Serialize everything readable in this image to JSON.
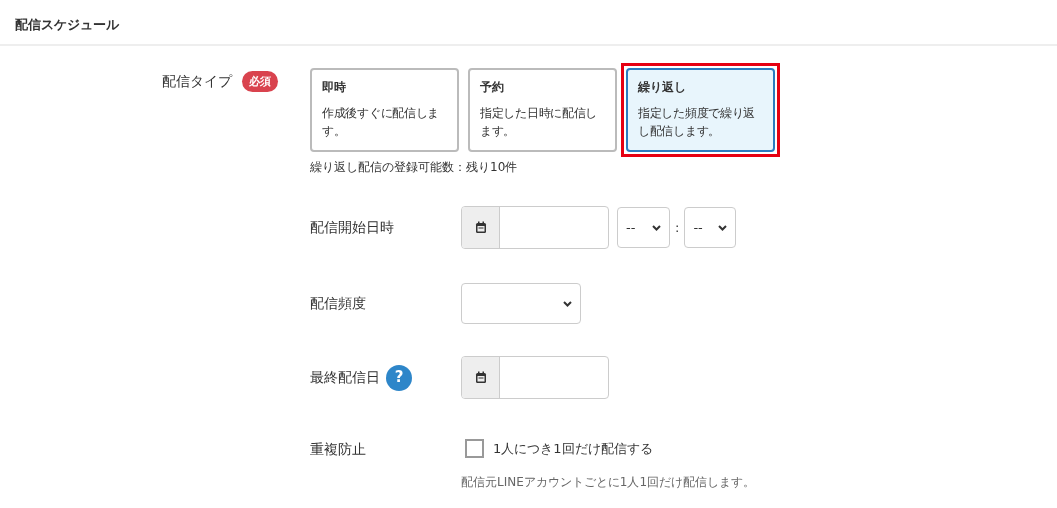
{
  "section_title": "配信スケジュール",
  "delivery_type": {
    "label": "配信タイプ",
    "badge": "必須",
    "options": [
      {
        "title": "即時",
        "description": "作成後すぐに配信します。",
        "selected": false,
        "highlighted": false
      },
      {
        "title": "予約",
        "description": "指定した日時に配信します。",
        "selected": false,
        "highlighted": false
      },
      {
        "title": "繰り返し",
        "description": "指定した頻度で繰り返し配信します。",
        "selected": true,
        "highlighted": true
      }
    ],
    "note": "繰り返し配信の登録可能数：残り10件"
  },
  "start": {
    "label": "配信開始日時",
    "hour": "--",
    "separator": ":",
    "minute": "--"
  },
  "frequency": {
    "label": "配信頻度"
  },
  "end": {
    "label": "最終配信日",
    "help": "?"
  },
  "dedupe": {
    "label": "重複防止",
    "checkbox_label": "1人につき1回だけ配信する",
    "checked": false,
    "help_text": "配信元LINEアカウントごとに1人1回だけ配信します。"
  }
}
